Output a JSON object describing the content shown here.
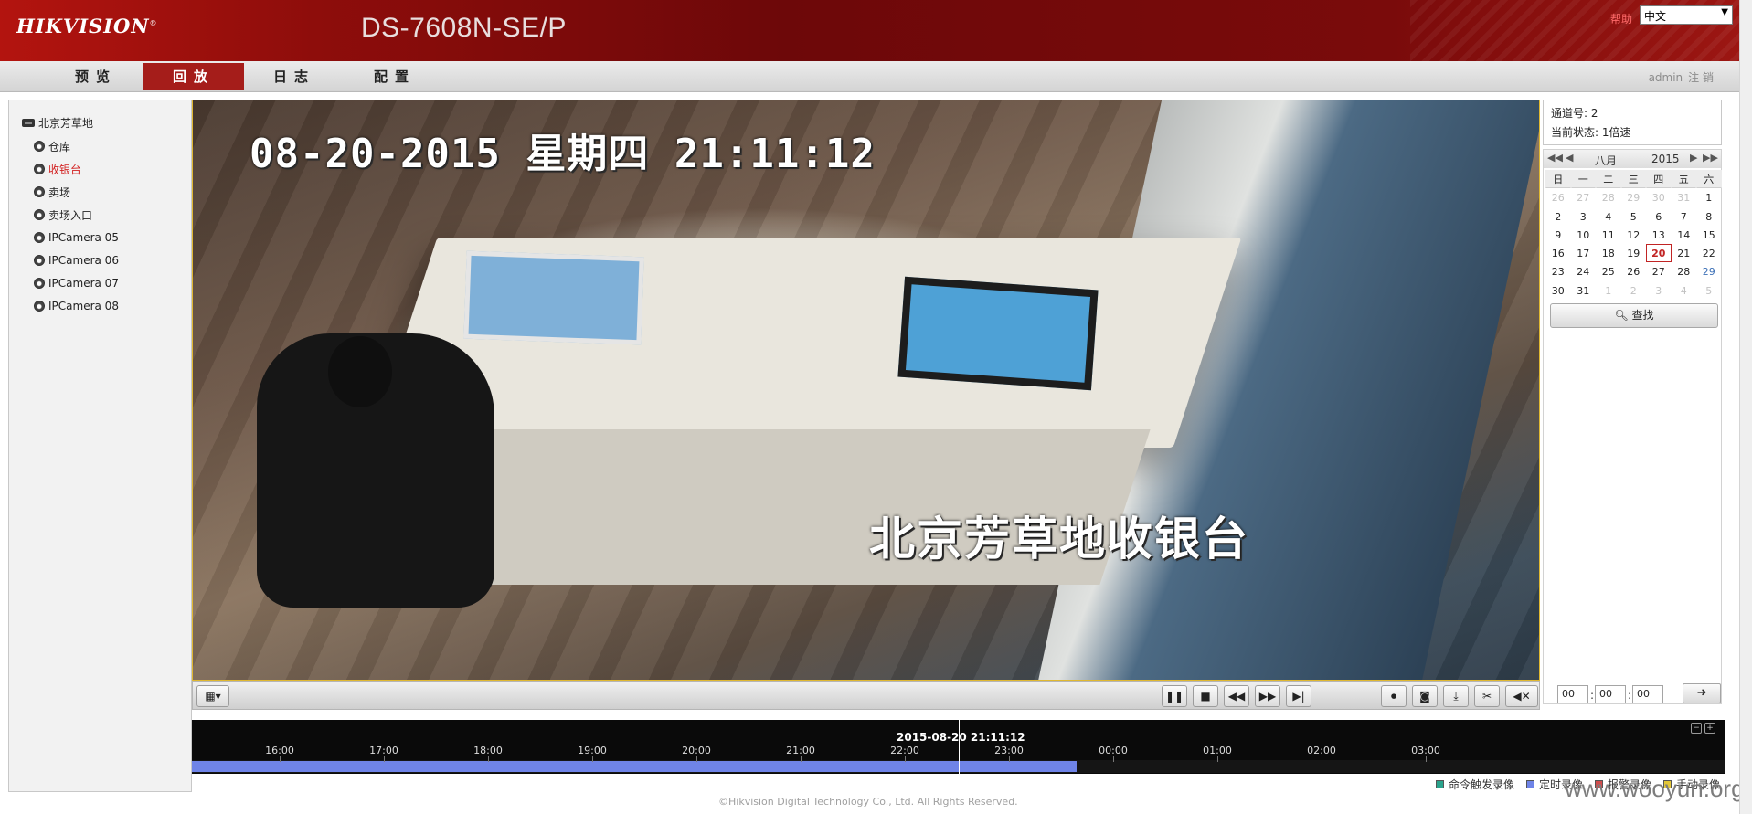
{
  "header": {
    "logo": "HIKVISION",
    "model": "DS-7608N-SE/P",
    "help": "帮助",
    "language": "中文"
  },
  "nav": {
    "tabs": [
      "预览",
      "回放",
      "日志",
      "配置"
    ],
    "active": "回放",
    "user": "admin",
    "logout": "注 销"
  },
  "tree": {
    "root": "北京芳草地",
    "items": [
      {
        "label": "仓库"
      },
      {
        "label": "收银台",
        "active": true
      },
      {
        "label": "卖场"
      },
      {
        "label": "卖场入口"
      },
      {
        "label": "IPCamera 05"
      },
      {
        "label": "IPCamera 06"
      },
      {
        "label": "IPCamera 07"
      },
      {
        "label": "IPCamera 08"
      }
    ]
  },
  "video": {
    "osd_time": "08-20-2015 星期四 21:11:12",
    "osd_name": "北京芳草地收银台"
  },
  "toolbar": {
    "icons": [
      "layout-grid-icon",
      "pause-icon",
      "stop-icon",
      "rewind-icon",
      "fast-forward-icon",
      "step-frame-icon",
      "clip-record-icon",
      "snapshot-icon",
      "download-icon",
      "cut-icon",
      "volume-mute-icon"
    ]
  },
  "status": {
    "channel": "通道号: 2",
    "state": "当前状态: 1倍速"
  },
  "calendar": {
    "month": "八月",
    "year": "2015",
    "weekdays": [
      "日",
      "一",
      "二",
      "三",
      "四",
      "五",
      "六"
    ],
    "days": [
      {
        "d": "26",
        "dim": true
      },
      {
        "d": "27",
        "dim": true
      },
      {
        "d": "28",
        "dim": true
      },
      {
        "d": "29",
        "dim": true
      },
      {
        "d": "30",
        "dim": true
      },
      {
        "d": "31",
        "dim": true
      },
      {
        "d": "1"
      },
      {
        "d": "2"
      },
      {
        "d": "3"
      },
      {
        "d": "4"
      },
      {
        "d": "5"
      },
      {
        "d": "6"
      },
      {
        "d": "7"
      },
      {
        "d": "8"
      },
      {
        "d": "9"
      },
      {
        "d": "10"
      },
      {
        "d": "11"
      },
      {
        "d": "12"
      },
      {
        "d": "13"
      },
      {
        "d": "14"
      },
      {
        "d": "15"
      },
      {
        "d": "16"
      },
      {
        "d": "17"
      },
      {
        "d": "18"
      },
      {
        "d": "19"
      },
      {
        "d": "20",
        "selected": true
      },
      {
        "d": "21"
      },
      {
        "d": "22"
      },
      {
        "d": "23"
      },
      {
        "d": "24"
      },
      {
        "d": "25"
      },
      {
        "d": "26"
      },
      {
        "d": "27"
      },
      {
        "d": "28"
      },
      {
        "d": "29",
        "blue": true
      },
      {
        "d": "30"
      },
      {
        "d": "31"
      },
      {
        "d": "1",
        "dim": true
      },
      {
        "d": "2",
        "dim": true
      },
      {
        "d": "3",
        "dim": true
      },
      {
        "d": "4",
        "dim": true
      },
      {
        "d": "5",
        "dim": true
      }
    ],
    "search": "查找"
  },
  "time_input": {
    "hh": "00",
    "mm": "00",
    "ss": "00"
  },
  "timeline": {
    "current": "2015-08-20 21:11:12",
    "hours": [
      "16:00",
      "17:00",
      "18:00",
      "19:00",
      "20:00",
      "21:00",
      "22:00",
      "23:00",
      "00:00",
      "01:00",
      "02:00",
      "03:00"
    ],
    "record_color": "#6f84e8"
  },
  "legend": [
    {
      "label": "命令触发录像",
      "color": "#2aa38c"
    },
    {
      "label": "定时录像",
      "color": "#6f84e8"
    },
    {
      "label": "报警录像",
      "color": "#d24d4d"
    },
    {
      "label": "手动录像",
      "color": "#e3c637"
    }
  ],
  "footer": "©Hikvision Digital Technology Co., Ltd. All Rights Reserved.",
  "watermark": "www.wooyun.org"
}
